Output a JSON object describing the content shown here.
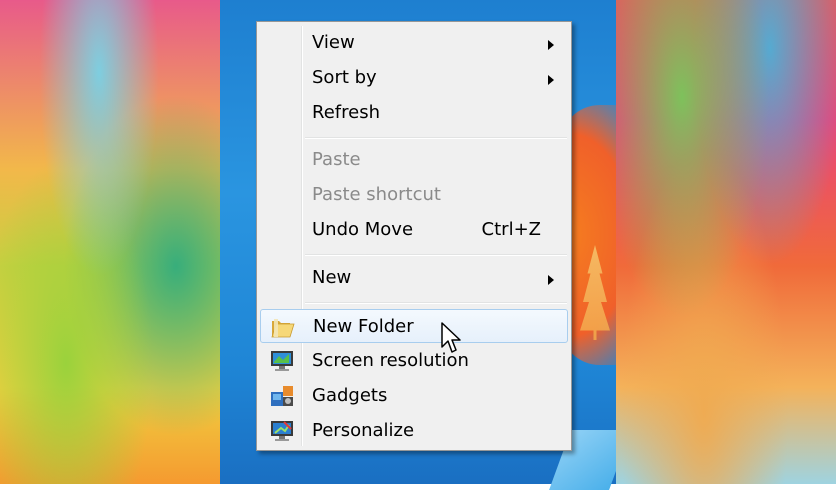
{
  "menu": {
    "items": [
      {
        "label": "View",
        "submenu": true
      },
      {
        "label": "Sort by",
        "submenu": true
      },
      {
        "label": "Refresh"
      },
      {
        "label": "Paste",
        "disabled": true
      },
      {
        "label": "Paste shortcut",
        "disabled": true
      },
      {
        "label": "Undo Move",
        "shortcut": "Ctrl+Z"
      },
      {
        "label": "New",
        "submenu": true
      },
      {
        "label": "New Folder",
        "icon": "folder-icon",
        "highlighted": true
      },
      {
        "label": "Screen resolution",
        "icon": "monitor-icon"
      },
      {
        "label": "Gadgets",
        "icon": "gadgets-icon"
      },
      {
        "label": "Personalize",
        "icon": "personalize-icon"
      }
    ]
  },
  "colors": {
    "menu_bg": "#f0f0f0",
    "hover_border": "#a8cdee",
    "disabled_text": "#8a8a8a",
    "desktop_blue": "#1e7fd0"
  }
}
